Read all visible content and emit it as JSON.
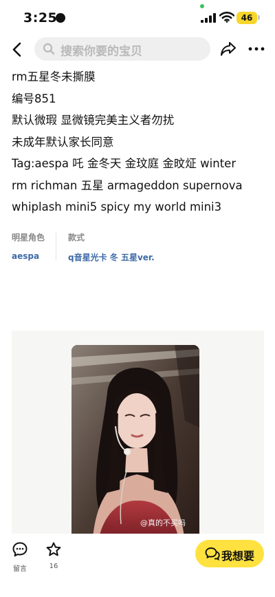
{
  "status_bar": {
    "time": "3:25",
    "battery": "46"
  },
  "nav": {
    "search_placeholder": "搜索你要的宝贝"
  },
  "description": {
    "lines": [
      "rm五星冬未撕膜",
      "编号851",
      "默认微瑕 显微镜完美主义者勿扰",
      "未成年默认家长同意",
      "Tag:aespa 吒 金冬天 金玟庭 金旼炡 winter",
      "rm richman 五星 armageddon supernova",
      "whiplash mini5 spicy my world mini3"
    ]
  },
  "attributes": [
    {
      "key": "明星角色",
      "value": "aespa"
    },
    {
      "key": "款式",
      "value": "q音星光卡 冬 五星ver."
    }
  ],
  "photo": {
    "watermark": "@真的不买吗"
  },
  "bottom_bar": {
    "comment_label": "留言",
    "favorite_count": "16",
    "want_label": "我想要"
  },
  "colors": {
    "accent": "#ffe23f",
    "link": "#3d6aa6",
    "search_bg": "#efefef"
  }
}
